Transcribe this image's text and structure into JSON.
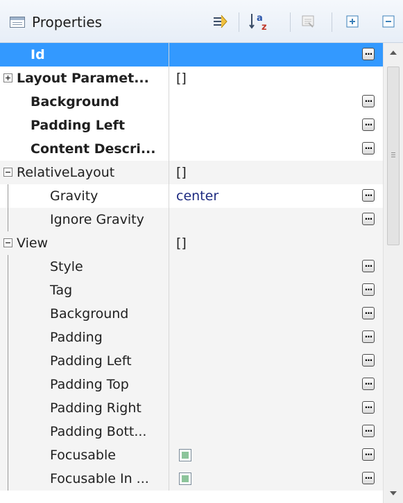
{
  "header": {
    "title": "Properties",
    "toolbar": [
      {
        "name": "show-advanced-icon"
      },
      {
        "name": "sort-alphabetically-icon"
      },
      {
        "name": "restore-default-icon"
      },
      {
        "name": "expand-all-icon"
      },
      {
        "name": "collapse-all-icon"
      }
    ]
  },
  "rows": [
    {
      "label": "Id",
      "value": "",
      "style": "selected",
      "bold": true,
      "expander": null,
      "ellipsis": true
    },
    {
      "label": "Layout Paramet...",
      "value": "[]",
      "style": "white",
      "bold": true,
      "expander": "plus",
      "ellipsis": false
    },
    {
      "label": "Background",
      "value": "",
      "style": "white",
      "bold": true,
      "expander": null,
      "ellipsis": true
    },
    {
      "label": "Padding Left",
      "value": "",
      "style": "white",
      "bold": true,
      "expander": null,
      "ellipsis": true
    },
    {
      "label": "Content Descri...",
      "value": "",
      "style": "white",
      "bold": true,
      "expander": null,
      "ellipsis": true
    },
    {
      "label": "RelativeLayout",
      "value": "[]",
      "style": "shaded",
      "bold": false,
      "expander": "minus",
      "ellipsis": false
    },
    {
      "label": "Gravity",
      "value": "center",
      "style": "white",
      "bold": false,
      "expander": null,
      "ellipsis": true,
      "indent": true,
      "valueStyle": "blue"
    },
    {
      "label": "Ignore Gravity",
      "value": "",
      "style": "shaded",
      "bold": false,
      "expander": null,
      "ellipsis": true,
      "indent": true
    },
    {
      "label": "View",
      "value": "[]",
      "style": "shaded",
      "bold": false,
      "expander": "minus",
      "ellipsis": false
    },
    {
      "label": "Style",
      "value": "",
      "style": "shaded",
      "bold": false,
      "ellipsis": true,
      "indent": true
    },
    {
      "label": "Tag",
      "value": "",
      "style": "shaded",
      "bold": false,
      "ellipsis": true,
      "indent": true
    },
    {
      "label": "Background",
      "value": "",
      "style": "shaded",
      "bold": false,
      "ellipsis": true,
      "indent": true
    },
    {
      "label": "Padding",
      "value": "",
      "style": "shaded",
      "bold": false,
      "ellipsis": true,
      "indent": true
    },
    {
      "label": "Padding Left",
      "value": "",
      "style": "shaded",
      "bold": false,
      "ellipsis": true,
      "indent": true
    },
    {
      "label": "Padding Top",
      "value": "",
      "style": "shaded",
      "bold": false,
      "ellipsis": true,
      "indent": true
    },
    {
      "label": "Padding Right",
      "value": "",
      "style": "shaded",
      "bold": false,
      "ellipsis": true,
      "indent": true
    },
    {
      "label": "Padding Bott...",
      "value": "",
      "style": "shaded",
      "bold": false,
      "ellipsis": true,
      "indent": true
    },
    {
      "label": "Focusable",
      "value": "",
      "style": "shaded",
      "bold": false,
      "ellipsis": true,
      "indent": true,
      "checkbox": true
    },
    {
      "label": "Focusable In ...",
      "value": "",
      "style": "shaded",
      "bold": false,
      "ellipsis": true,
      "indent": true,
      "checkbox": true
    }
  ],
  "ellipsis_label": "...",
  "colors": {
    "selection": "#3399ff",
    "value_text": "#1d2a80"
  }
}
